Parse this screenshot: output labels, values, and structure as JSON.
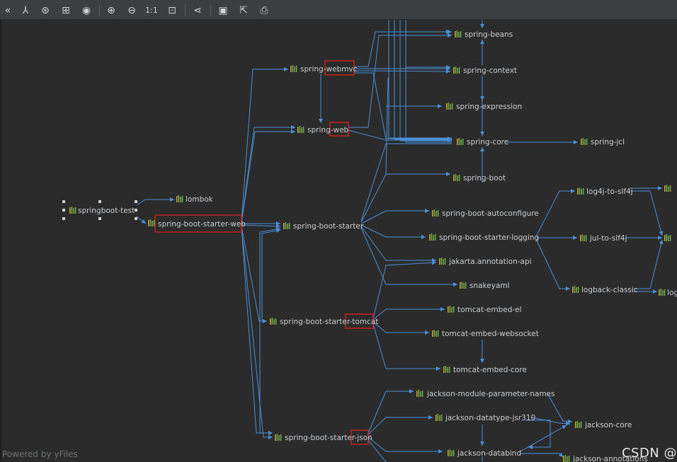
{
  "toolbar": {
    "buttons": [
      {
        "name": "collapse-icon",
        "glyph": "«"
      },
      {
        "name": "layout-icon",
        "glyph": "⅄"
      },
      {
        "name": "fit-content-icon",
        "glyph": "⊛"
      },
      {
        "name": "select-icon",
        "glyph": "⊞"
      },
      {
        "name": "show-icon",
        "glyph": "◉"
      },
      {
        "name": "zoom-in-icon",
        "glyph": "⊕"
      },
      {
        "name": "zoom-out-icon",
        "glyph": "⊖"
      },
      {
        "name": "actual-size-icon",
        "glyph": "1:1"
      },
      {
        "name": "fit-page-icon",
        "glyph": "⊡"
      },
      {
        "name": "share-icon",
        "glyph": "⋖"
      },
      {
        "name": "save-icon",
        "glyph": "▣"
      },
      {
        "name": "export-icon",
        "glyph": "⇱"
      },
      {
        "name": "print-icon",
        "glyph": "⎙"
      }
    ]
  },
  "nodes": {
    "root": "springboot-test",
    "lombok": "lombok",
    "starter_web": "spring-boot-starter-web",
    "webmvc": "spring-webmvc",
    "web": "spring-web",
    "starter": "spring-boot-starter",
    "starter_tomcat": "spring-boot-starter-tomcat",
    "starter_json": "spring-boot-starter-json",
    "beans": "spring-beans",
    "context": "spring-context",
    "expression": "spring-expression",
    "core": "spring-core",
    "jcl": "spring-jcl",
    "boot": "spring-boot",
    "autoconfigure": "spring-boot-autoconfigure",
    "starter_logging": "spring-boot-starter-logging",
    "jakarta": "jakarta.annotation-api",
    "snakeyaml": "snakeyaml",
    "tomcat_el": "tomcat-embed-el",
    "tomcat_ws": "tomcat-embed-websocket",
    "tomcat_core": "tomcat-embed-core",
    "log4j": "log4j-to-slf4j",
    "jul": "jul-to-slf4j",
    "logback": "logback-classic",
    "logback_cut": "log",
    "jackson_param": "jackson-module-parameter-names",
    "jackson_jsr310": "jackson-datatype-jsr310",
    "jackson_databind": "jackson-databind",
    "jackson_core": "jackson-core",
    "jackson_annotations": "jackson-annotations"
  },
  "footer": {
    "powered": "Powered by yFiles",
    "watermark": "CSDN @"
  },
  "colors": {
    "edge": "#4a8fd8",
    "highlight": "#e02020",
    "background": "#2b2b2b"
  }
}
